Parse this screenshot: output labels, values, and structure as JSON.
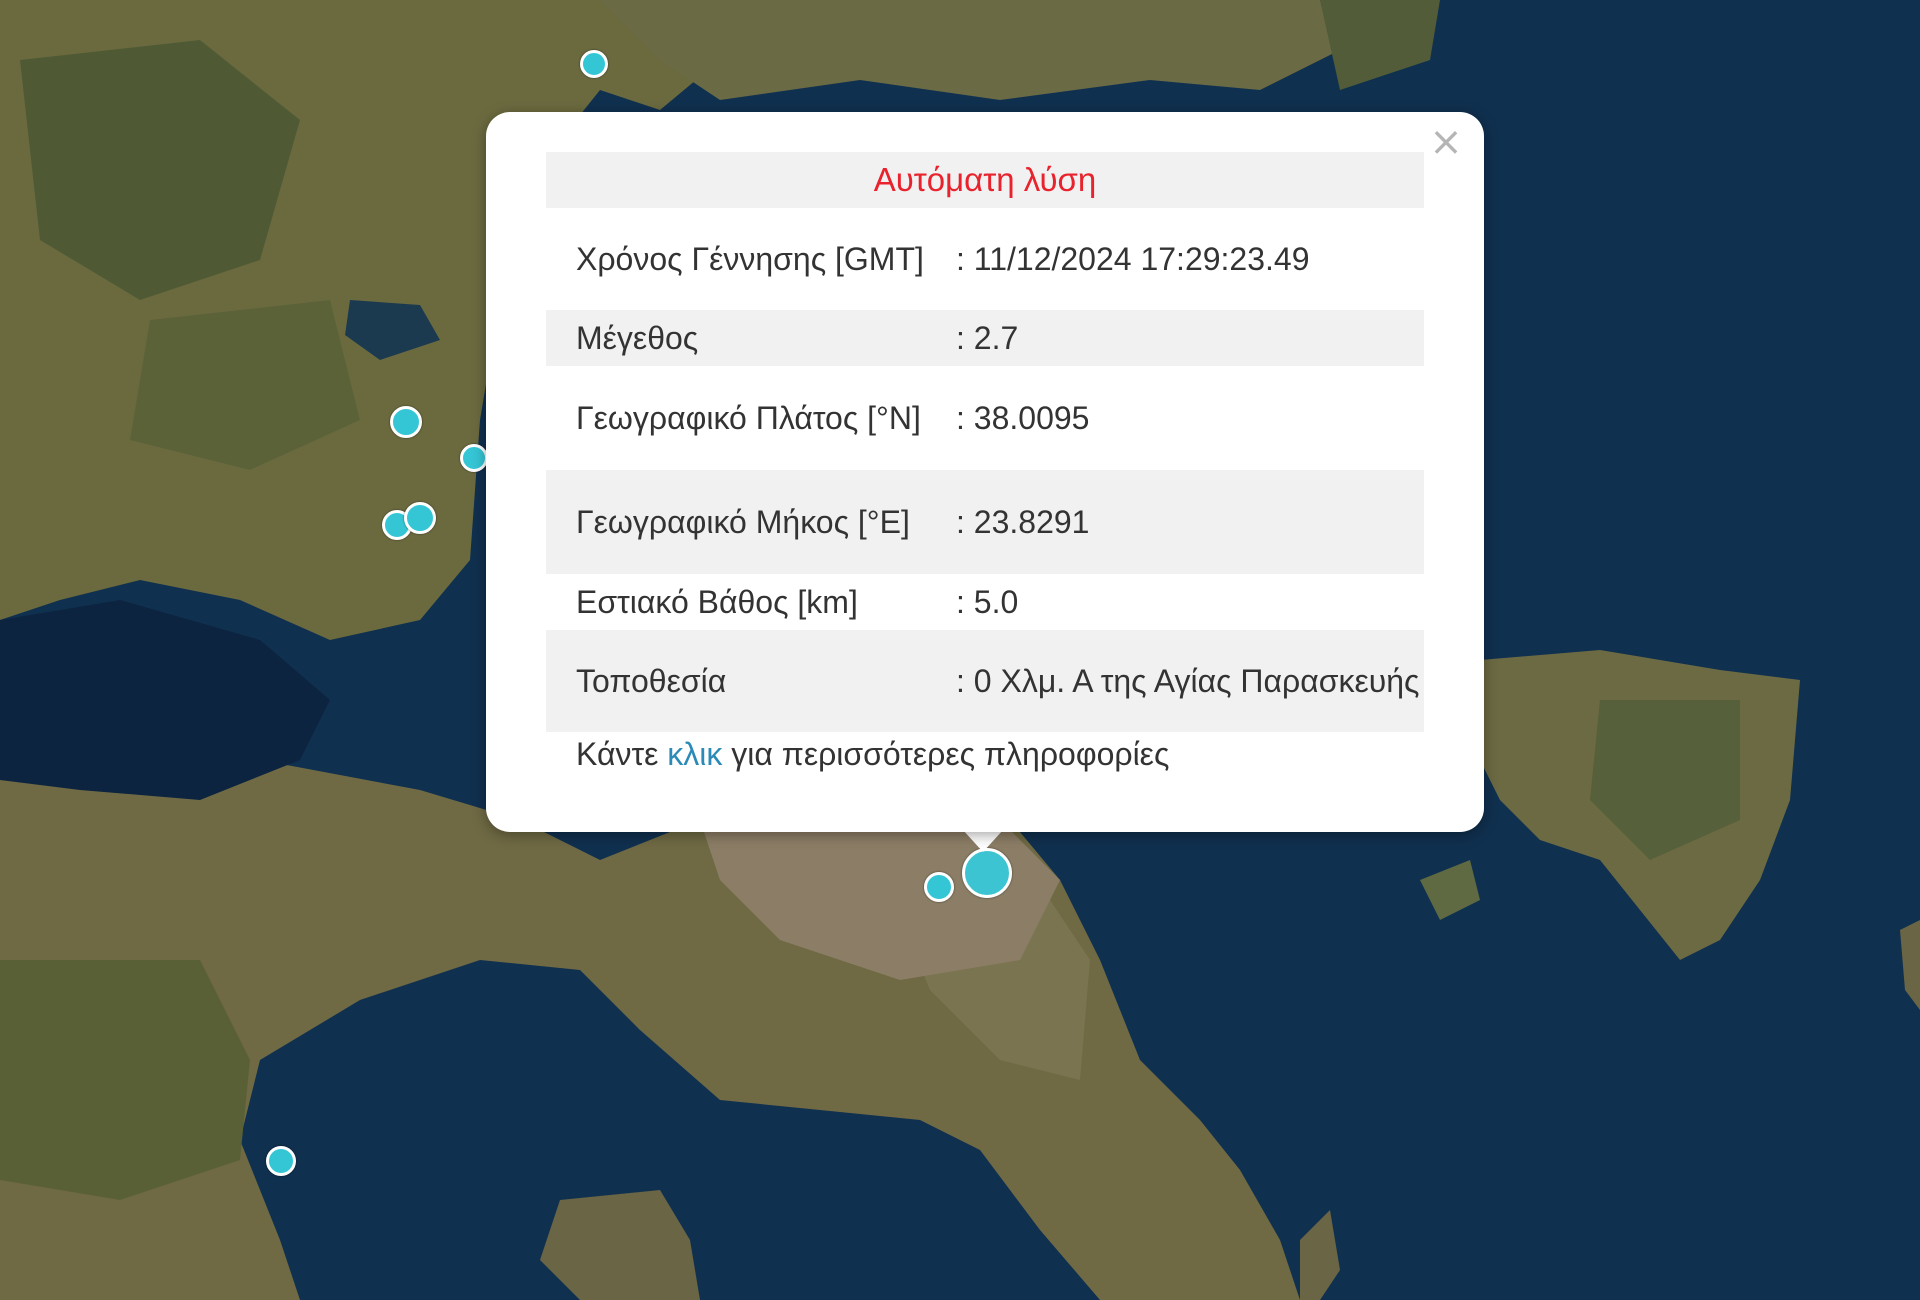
{
  "popup": {
    "header": "Αυτόματη λύση",
    "close_icon": "close-icon",
    "rows": [
      {
        "label": "Χρόνος Γέννησης [GMT]",
        "value": ": 11/12/2024 17:29:23.49"
      },
      {
        "label": "Μέγεθος",
        "value": ": 2.7"
      },
      {
        "label": "Γεωγραφικό Πλάτος [°N]",
        "value": ": 38.0095"
      },
      {
        "label": "Γεωγραφικό Μήκος [°E]",
        "value": ": 23.8291"
      },
      {
        "label": "Εστιακό Βάθος [km]",
        "value": ": 5.0"
      },
      {
        "label": "Τοποθεσία",
        "value": ": 0 Χλμ. Α της Αγίας Παρασκευής"
      }
    ],
    "footer_prefix": "Κάντε ",
    "footer_link": "κλικ",
    "footer_suffix": " για περισσότερες πληροφορίες"
  },
  "colors": {
    "header_text": "#e8232d",
    "link": "#2b8ab8",
    "marker": "#35c6d6"
  }
}
